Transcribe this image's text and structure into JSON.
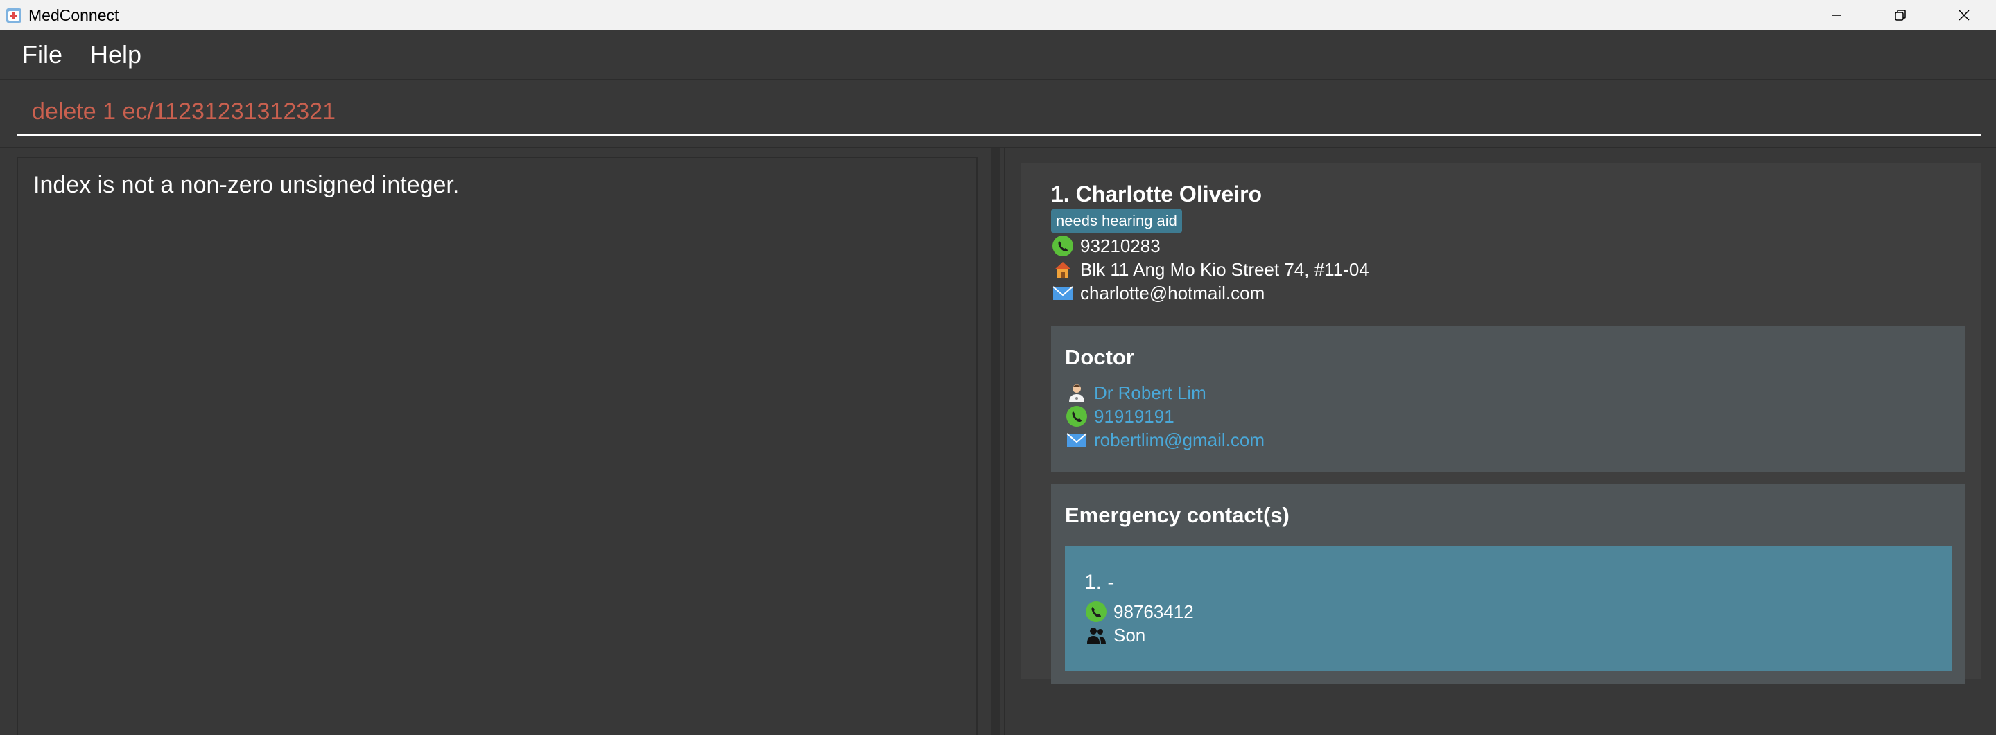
{
  "window": {
    "title": "MedConnect"
  },
  "menu": {
    "items": [
      "File",
      "Help"
    ]
  },
  "command": {
    "value": "delete 1 ec/11231231312321"
  },
  "result": {
    "message": "Index is not a non-zero unsigned integer."
  },
  "person": {
    "name": "1. Charlotte Oliveiro",
    "tag": "needs hearing aid",
    "phone": "93210283",
    "address": "Blk 11 Ang Mo Kio Street 74, #11-04",
    "email": "charlotte@hotmail.com",
    "doctor": {
      "section_title": "Doctor",
      "name": "Dr Robert Lim",
      "phone": "91919191",
      "email": "robertlim@gmail.com"
    },
    "emergency": {
      "section_title": "Emergency contact(s)",
      "contacts": [
        {
          "name": "1. -",
          "phone": "98763412",
          "relationship": "Son"
        }
      ]
    }
  },
  "icons": {
    "phone": "phone-icon",
    "home": "home-icon",
    "email": "email-icon",
    "doctor": "doctor-icon",
    "relationship": "people-icon"
  },
  "colors": {
    "command_text": "#c9604f",
    "tag_bg": "#3e7b91",
    "doctor_link": "#4aa8d8",
    "ec_card_bg": "#4e8599"
  }
}
